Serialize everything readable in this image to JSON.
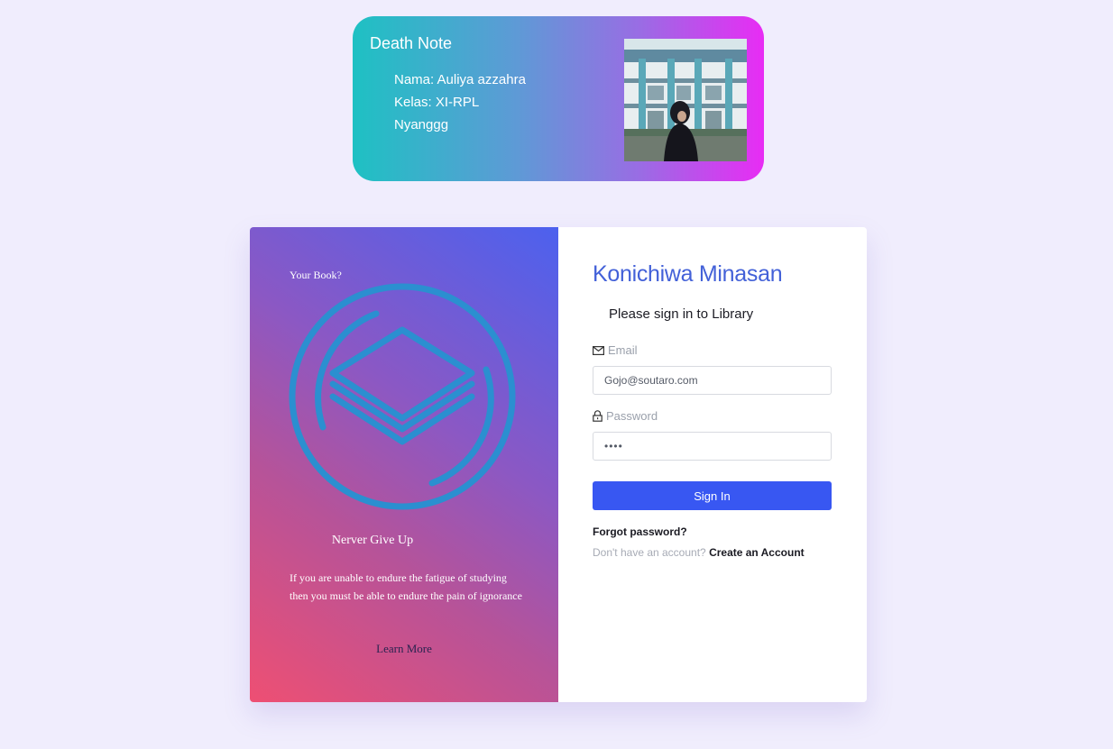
{
  "profile": {
    "title": "Death Note",
    "name_line": "Nama: Auliya azzahra",
    "class_line": "Kelas: XI-RPL",
    "extra_line": "Nyanggg"
  },
  "promo": {
    "question": "Your Book?",
    "quote_title": "Nerver Give Up",
    "quote": "If you are unable to endure the fatigue of studying then you must be able to endure the pain of ignorance",
    "learn_more": "Learn More",
    "logo_icon": "book-stack-icon"
  },
  "login": {
    "greeting": "Konichiwa Minasan",
    "subtitle": "Please sign in to Library",
    "email_label": "Email",
    "email_value": "Gojo@soutaro.com",
    "password_label": "Password",
    "password_value": "••••",
    "signin_label": "Sign In",
    "forgot_label": "Forgot password?",
    "no_account_text": "Don't have an account?",
    "create_account_label": "Create an Account"
  },
  "colors": {
    "page_background": "#f0edfd",
    "accent": "#3857f2",
    "greeting": "#4361d8",
    "logo": "#2b8fd0"
  }
}
